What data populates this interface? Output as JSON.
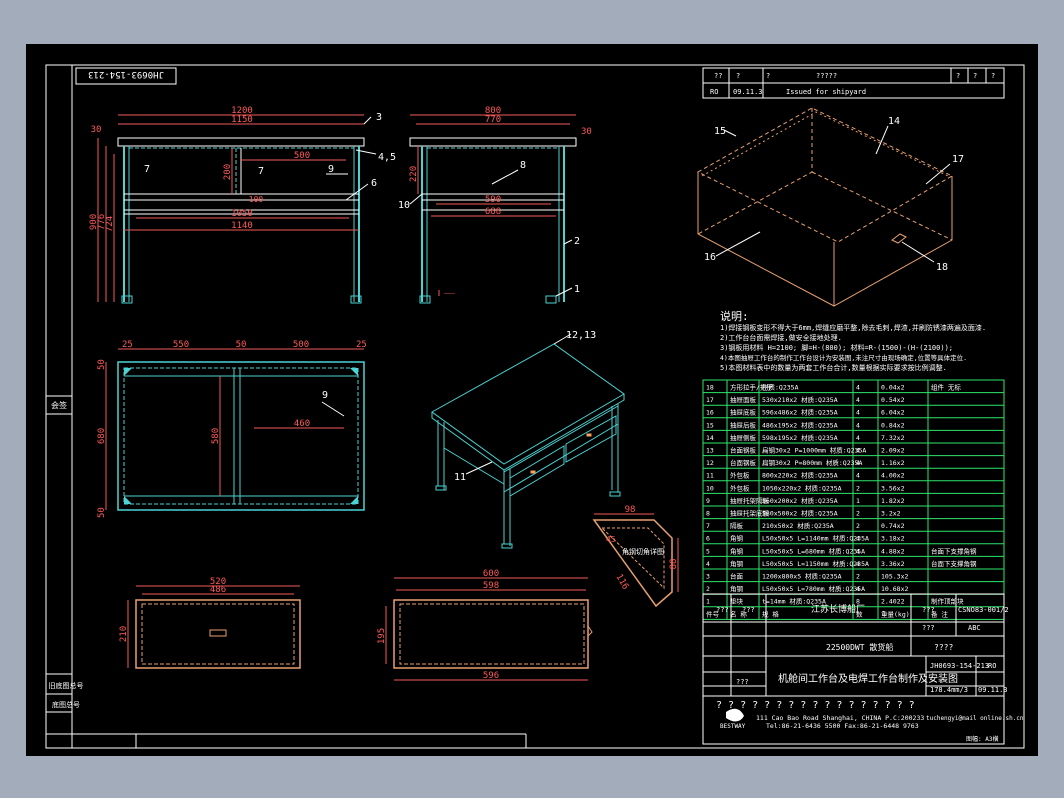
{
  "drawing": {
    "stamp_top_left": "JH0693-154-213",
    "revision_header": [
      "??",
      "?",
      "?",
      "?????",
      "?",
      "?",
      "?"
    ],
    "revision_row": [
      "RO",
      "09.11.3",
      "Issued for shipyard"
    ],
    "front_dims": {
      "w_outer": "1200",
      "w_inner": "1150",
      "w_lower": "1050",
      "w_base": "1140",
      "drawer": "500",
      "h_total": "900",
      "h_mid": "776",
      "h_leg": "724",
      "h_drawer": "200",
      "gap": "30",
      "gap2": "100"
    },
    "side_dims": {
      "w_outer": "800",
      "w_inner": "770",
      "w_lower": "590",
      "w_base": "688",
      "h": "220",
      "gap": "30"
    },
    "plan_dims": {
      "a": "25",
      "b": "550",
      "c": "50",
      "d": "500",
      "e": "25",
      "h_total": "680",
      "h_inner": "580",
      "w_divider": "460",
      "bottom1": "50",
      "bottom2": "50"
    },
    "drawer_plan_dims": {
      "w_outer": "520",
      "w_inner": "486",
      "h": "210"
    },
    "drawer_side_dims": {
      "w_outer": "600",
      "w_inner": "598",
      "h": "195",
      "w_bottom": "596"
    },
    "gusset_dims": {
      "w": "98",
      "angle": "45",
      "h": "88",
      "len": "116",
      "note": "角钢切角详图"
    },
    "balloons": {
      "b3": "3",
      "b4_5": "4,5",
      "b7a": "7",
      "b7b": "7",
      "b9": "9",
      "b6": "6",
      "b8": "8",
      "b10": "10",
      "b2": "2",
      "b1": "1",
      "b9b": "9",
      "b12_13": "12,13",
      "b11": "11",
      "b14": "14",
      "b15": "15",
      "b16": "16",
      "b17": "17",
      "b18": "18"
    },
    "notes_title": "说明:",
    "notes": [
      "1)焊接钢板变形不得大于6mm,焊缝应磨平整,除去毛刺,焊渣,并刷防锈漆两遍及面漆.",
      "2)工作台台面需焊接,做安全接地处理.",
      "3)钢板用材料 H=2100; 脚=H-(800); 材料=R-(1500)-(H-(2100));",
      "4)本图抽屉工作台的制作工作台设计为安装图,未注尺寸由现场确定,位置等具体定位.",
      "5)本图材料表中的数量为两套工作台合计,数量根据实际要求按比例调整."
    ],
    "side_labels": [
      "会签",
      "旧底图总号",
      "底图总号"
    ],
    "bom_rows": [
      [
        "18",
        "方形拉手/把手",
        "材质:Q235A",
        "4",
        "0.04x2",
        "组件 无标"
      ],
      [
        "17",
        "抽屉面板",
        "530x210x2 材质:Q235A",
        "4",
        "0.54x2",
        ""
      ],
      [
        "16",
        "抽屉底板",
        "596x486x2 材质:Q235A",
        "4",
        "6.04x2",
        ""
      ],
      [
        "15",
        "抽屉后板",
        "486x195x2 材质:Q235A",
        "4",
        "0.84x2",
        ""
      ],
      [
        "14",
        "抽屉侧板",
        "598x195x2 材质:Q235A",
        "4",
        "7.32x2",
        ""
      ],
      [
        "13",
        "台面钢板",
        "扁钢30x2 P=1000mm 材质:Q235A",
        "4",
        "2.09x2",
        ""
      ],
      [
        "12",
        "台面钢板",
        "扁钢30x2 P=800mm 材质:Q235A",
        "4",
        "1.16x2",
        ""
      ],
      [
        "11",
        "外包板",
        "800x220x2 材质:Q235A",
        "4",
        "4.00x2",
        ""
      ],
      [
        "10",
        "外包板",
        "1050x220x2 材质:Q235A",
        "2",
        "3.56x2",
        ""
      ],
      [
        "9",
        "抽屉托架隔板",
        "560x200x2 材质:Q235A",
        "1",
        "1.82x2",
        ""
      ],
      [
        "8",
        "抽屉托架底板",
        "580x500x2 材质:Q235A",
        "2",
        "3.2x2",
        ""
      ],
      [
        "7",
        "隔板",
        "210x50x2 材质:Q235A",
        "2",
        "0.74x2",
        ""
      ],
      [
        "6",
        "角钢",
        "L50x50x5 L=1140mm 材质:Q235A",
        "4",
        "3.18x2",
        ""
      ],
      [
        "5",
        "角钢",
        "L50x50x5 L=680mm 材质:Q235A",
        "4",
        "4.88x2",
        "台面下支撑角钢"
      ],
      [
        "4",
        "角钢",
        "L50x50x5 L=1150mm 材质:Q235A",
        "4",
        "3.36x2",
        "台面下支撑角钢"
      ],
      [
        "3",
        "台面",
        "1200x800x5 材质:Q235A",
        "2",
        "105.3x2",
        ""
      ],
      [
        "2",
        "角钢",
        "L50x50x5 L=780mm 材质:Q235A",
        "4",
        "10.68x2",
        ""
      ],
      [
        "1",
        "垫块",
        "t=14mm 材质:Q235A",
        "8",
        "2.4022",
        "制作顶部块"
      ]
    ],
    "bom_header": [
      "件号",
      "名  称",
      "规    格",
      "数",
      "重量(kg)",
      "备  注"
    ],
    "title_block": {
      "company": "江苏长博船厂",
      "drawing_no": "CSNO83-001/2",
      "ship": "22500DWT 散货船",
      "title": "机舱间工作台及电焊工作台制作及安装图",
      "code": "JH0693-154-213",
      "sheet_code": "178.4mm/3",
      "date": "09.11.3",
      "rev": "RO",
      "page": "ABC",
      "qmarks": "???",
      "qmarks2": "????",
      "qline": "? ? ? ? ? ? ? ? ? ? ? ? ? ? ? ? ?",
      "address": "111 Cao Bao Road Shanghai, CHINA   P.C:200233",
      "tel": "Tel:86-21-6436 5500   Fax:86-21-6448 9763",
      "email": "tuchengyi@mail online.sh.cn",
      "brand": "BESTWAY",
      "scale": "图幅: A3横"
    }
  }
}
